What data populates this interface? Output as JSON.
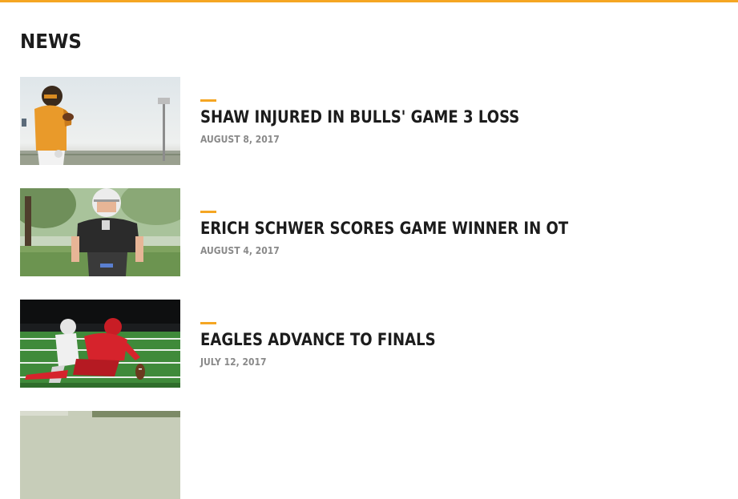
{
  "section": {
    "title": "NEWS"
  },
  "colors": {
    "accent": "#f5a623",
    "headline": "#1c1c1c",
    "date": "#8a8a8a"
  },
  "articles": [
    {
      "headline": "SHAW INJURED IN BULLS' GAME 3 LOSS",
      "date": "AUGUST 8, 2017",
      "image": "football-quarterback-photo"
    },
    {
      "headline": "ERICH SCHWER SCORES GAME WINNER IN OT",
      "date": "AUGUST 4, 2017",
      "image": "youth-football-player-photo"
    },
    {
      "headline": "EAGLES ADVANCE TO FINALS",
      "date": "JULY 12, 2017",
      "image": "football-tackle-photo"
    },
    {
      "headline": "",
      "date": "",
      "image": "partial-news-photo"
    }
  ]
}
